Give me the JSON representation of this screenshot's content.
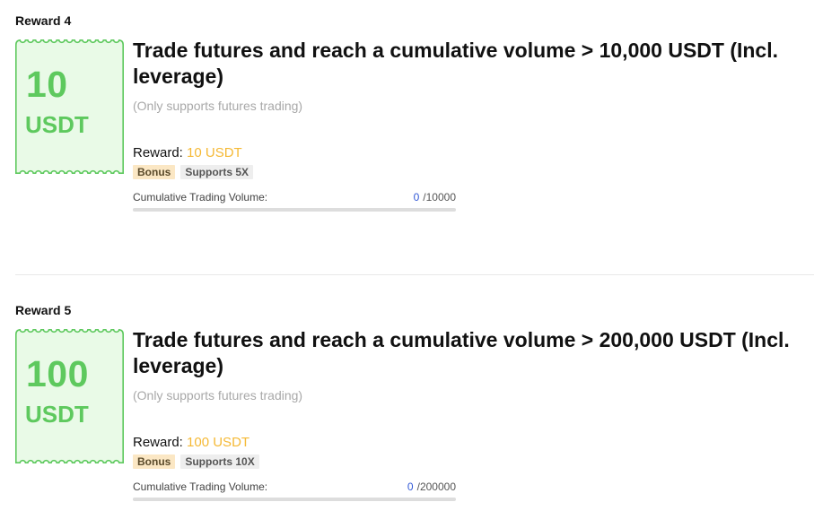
{
  "colors": {
    "ticket_green": "#5ec95e",
    "ticket_fill": "#e9fae7",
    "reward_orange": "#f5b935",
    "progress_blue": "#3158d6"
  },
  "rewards": [
    {
      "heading": "Reward 4",
      "ticket_amount": "10",
      "ticket_unit": "USDT",
      "title": "Trade futures and reach a cumulative volume > 10,000 USDT (Incl. leverage)",
      "note": "(Only supports futures trading)",
      "reward_label": "Reward:",
      "reward_value": "10 USDT",
      "tags": [
        "Bonus",
        "Supports 5X"
      ],
      "progress_label": "Cumulative Trading Volume:",
      "progress_current": "0",
      "progress_target": "/10000",
      "progress_fraction": 0
    },
    {
      "heading": "Reward 5",
      "ticket_amount": "100",
      "ticket_unit": "USDT",
      "title": "Trade futures and reach a cumulative volume > 200,000 USDT (Incl. leverage)",
      "note": "(Only supports futures trading)",
      "reward_label": "Reward:",
      "reward_value": "100 USDT",
      "tags": [
        "Bonus",
        "Supports 10X"
      ],
      "progress_label": "Cumulative Trading Volume:",
      "progress_current": "0",
      "progress_target": "/200000",
      "progress_fraction": 0
    }
  ]
}
